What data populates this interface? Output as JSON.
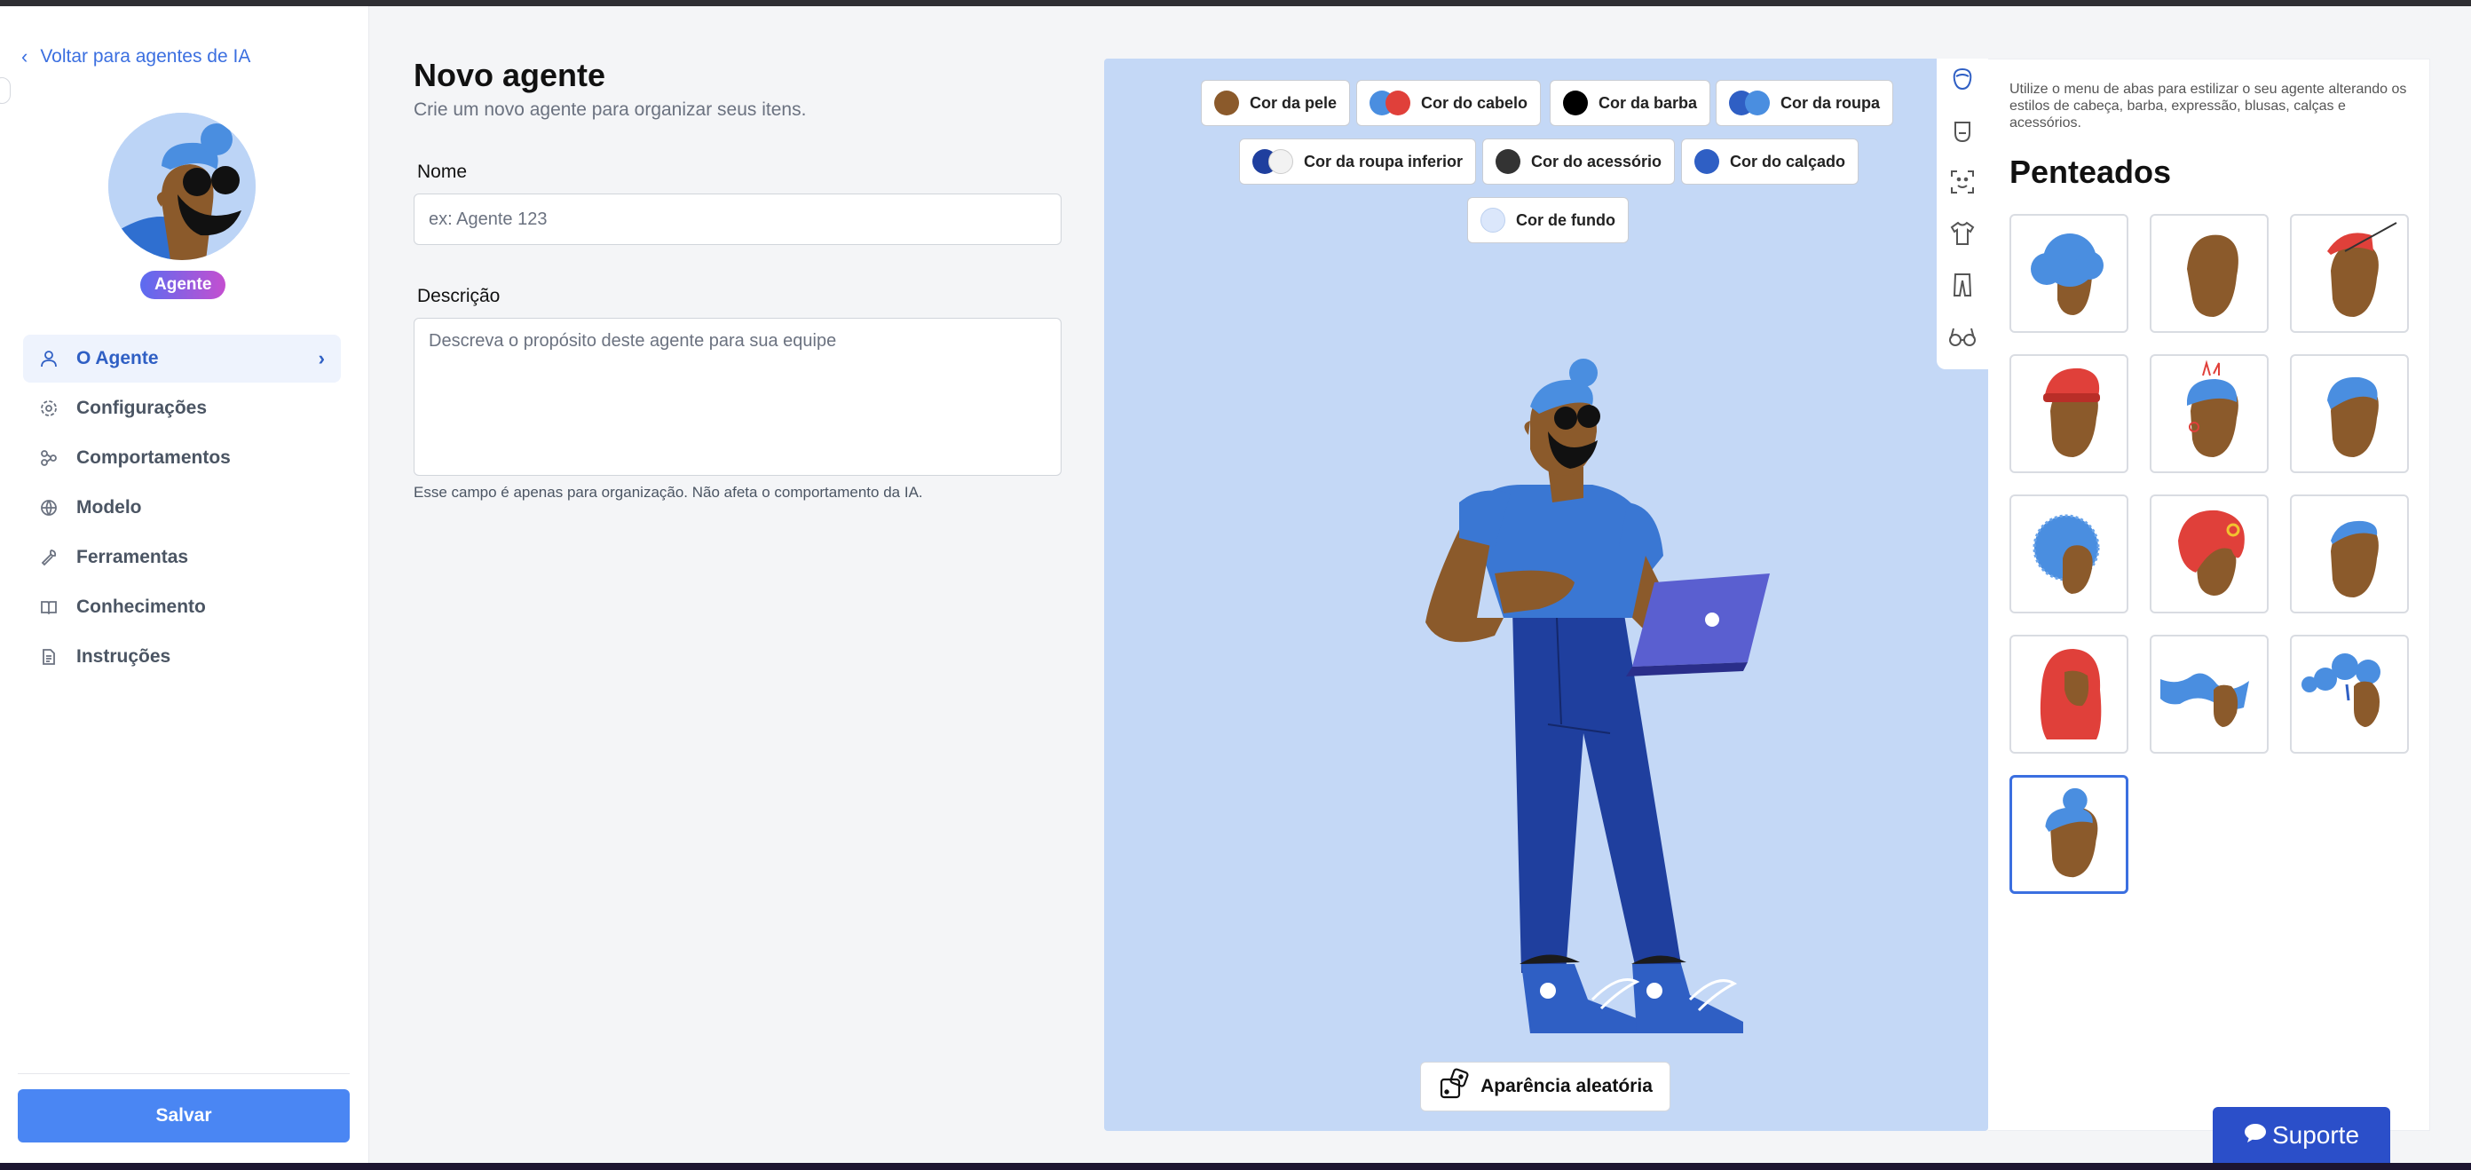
{
  "sidebar": {
    "back_label": "Voltar para agentes de IA",
    "badge": "Agente",
    "nav": [
      {
        "label": "O Agente",
        "icon": "user-icon",
        "active": true
      },
      {
        "label": "Configurações",
        "icon": "gear-icon"
      },
      {
        "label": "Comportamentos",
        "icon": "nodes-icon"
      },
      {
        "label": "Modelo",
        "icon": "globe-icon"
      },
      {
        "label": "Ferramentas",
        "icon": "wrench-icon"
      },
      {
        "label": "Conhecimento",
        "icon": "book-icon"
      },
      {
        "label": "Instruções",
        "icon": "document-icon"
      }
    ],
    "save_label": "Salvar"
  },
  "form": {
    "title": "Novo agente",
    "subtitle": "Crie um novo agente para organizar seus itens.",
    "name_label": "Nome",
    "name_placeholder": "ex: Agente 123",
    "description_label": "Descrição",
    "description_placeholder": "Descreva o propósito deste agente para sua equipe",
    "description_hint": "Esse campo é apenas para organização. Não afeta o comportamento da IA."
  },
  "editor": {
    "color_chips": [
      {
        "label": "Cor da pele",
        "colors": [
          "#8b5a2b"
        ]
      },
      {
        "label": "Cor do cabelo",
        "colors": [
          "#4a8ee0",
          "#e0403a"
        ]
      },
      {
        "label": "Cor da barba",
        "colors": [
          "#000000"
        ]
      },
      {
        "label": "Cor da roupa",
        "colors": [
          "#2f5fc4",
          "#4a8ee0"
        ]
      },
      {
        "label": "Cor da roupa inferior",
        "colors": [
          "#1f3f9e",
          "#f2f2f2"
        ]
      },
      {
        "label": "Cor do acessório",
        "colors": [
          "#333333"
        ]
      },
      {
        "label": "Cor do calçado",
        "colors": [
          "#2f5fc4"
        ]
      },
      {
        "label": "Cor de fundo",
        "colors": [
          "#c4d8f6"
        ]
      }
    ],
    "random_label": "Aparência aleatória",
    "background": "#c4d8f6"
  },
  "tabs": [
    "hair-icon",
    "beard-icon",
    "face-icon",
    "shirt-icon",
    "pants-icon",
    "glasses-icon"
  ],
  "panel": {
    "hint": "Utilize o menu de abas para estilizar o seu agente alterando os estilos de cabeça, barba, expressão, blusas, calças e acessórios.",
    "title": "Penteados",
    "hairstyles": [
      "afro",
      "bald",
      "cap",
      "beanie",
      "horns",
      "bun",
      "curly",
      "turban",
      "short",
      "hijab",
      "wind",
      "twin-buns",
      "top-bun"
    ],
    "selected_index": 12
  },
  "support_label": "Suporte"
}
